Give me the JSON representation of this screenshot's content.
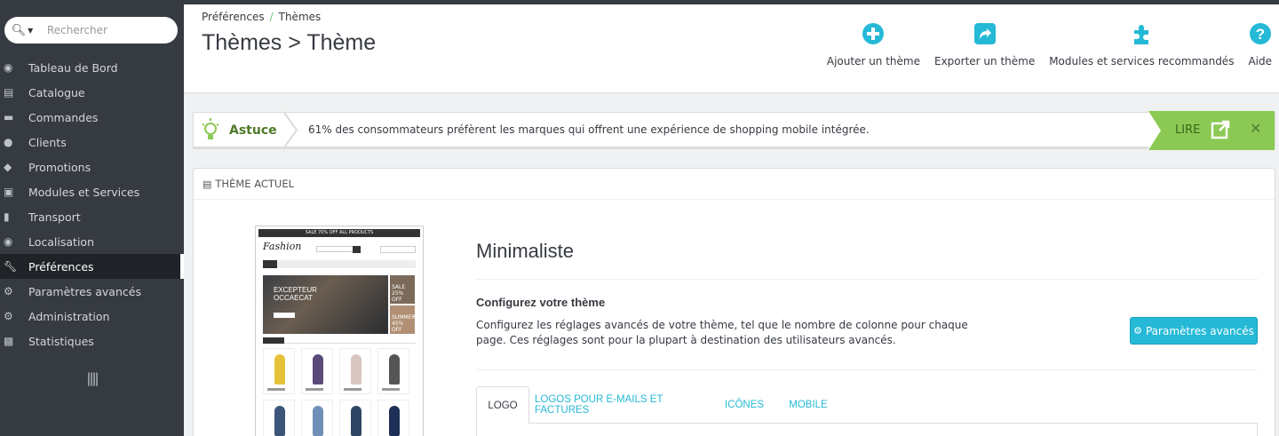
{
  "search": {
    "placeholder": "Rechercher"
  },
  "sidebar": {
    "items": [
      {
        "label": "Tableau de Bord",
        "icon": "dashboard-icon"
      },
      {
        "label": "Catalogue",
        "icon": "book-icon"
      },
      {
        "label": "Commandes",
        "icon": "credit-card-icon"
      },
      {
        "label": "Clients",
        "icon": "users-icon"
      },
      {
        "label": "Promotions",
        "icon": "tags-icon"
      },
      {
        "label": "Modules et Services",
        "icon": "puzzle-icon"
      },
      {
        "label": "Transport",
        "icon": "truck-icon"
      },
      {
        "label": "Localisation",
        "icon": "globe-icon"
      },
      {
        "label": "Préférences",
        "icon": "wrench-icon",
        "active": true
      },
      {
        "label": "Paramètres avancés",
        "icon": "cogs-icon"
      },
      {
        "label": "Administration",
        "icon": "gear-icon"
      },
      {
        "label": "Statistiques",
        "icon": "bar-chart-icon"
      }
    ]
  },
  "breadcrumb": {
    "parent": "Préférences",
    "current": "Thèmes"
  },
  "header": {
    "title": "Thèmes > Thème"
  },
  "toolbar": {
    "add_theme": "Ajouter un thème",
    "export_theme": "Exporter un thème",
    "modules": "Modules et services recommandés",
    "help": "Aide"
  },
  "tip": {
    "label": "Astuce",
    "text": "61% des consommateurs préfèrent les marques qui offrent une expérience de shopping mobile intégrée.",
    "read": "LIRE"
  },
  "panel": {
    "heading": "THÈME ACTUEL",
    "theme_name": "Minimaliste",
    "configure_title": "Configurez votre thème",
    "configure_desc": "Configurez les réglages avancés de votre thème, tel que le nombre de colonne pour chaque page. Ces réglages sont pour la plupart à destination des utilisateurs avancés.",
    "advanced_button": "Paramètres avancés"
  },
  "preview": {
    "promo": "SALE 70% OFF ALL PRODUCTS",
    "logo": "Fashion",
    "banner_line1": "EXCEPTEUR",
    "banner_line2": "OCCAECAT",
    "side1": "SALE 25% OFF",
    "side2": "SUMMER 45% OFF"
  },
  "tabs": [
    "LOGO",
    "LOGOS POUR E-MAILS ET FACTURES",
    "ICÔNES",
    "MOBILE"
  ],
  "colors": {
    "accent": "#25b9d7",
    "sidebar": "#363a41",
    "tip_green": "#8bc954"
  }
}
